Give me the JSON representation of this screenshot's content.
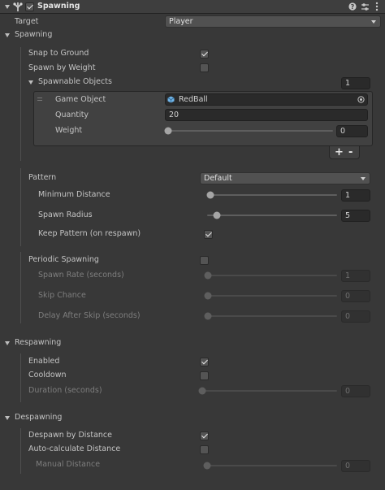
{
  "header": {
    "component_name": "Spawning"
  },
  "target": {
    "label": "Target",
    "value": "Player"
  },
  "spawning": {
    "label": "Spawning",
    "snap_to_ground": {
      "label": "Snap to Ground",
      "checked": true
    },
    "spawn_by_weight": {
      "label": "Spawn by Weight",
      "checked": false
    },
    "spawnable_objects": {
      "label": "Spawnable Objects",
      "count": "1",
      "element": {
        "game_object": {
          "label": "Game Object",
          "value": "RedBall"
        },
        "quantity": {
          "label": "Quantity",
          "value": "20"
        },
        "weight": {
          "label": "Weight",
          "value": "0",
          "slider_fraction": 0.0
        }
      },
      "add_label": "+",
      "remove_label": "-"
    },
    "pattern": {
      "label": "Pattern",
      "value": "Default",
      "minimum_distance": {
        "label": "Minimum Distance",
        "value": "1",
        "slider_fraction": 0.02
      },
      "spawn_radius": {
        "label": "Spawn Radius",
        "value": "5",
        "slider_fraction": 0.07
      },
      "keep_pattern": {
        "label": "Keep Pattern (on respawn)",
        "checked": true
      }
    },
    "periodic": {
      "label": "Periodic Spawning",
      "checked": false,
      "spawn_rate": {
        "label": "Spawn Rate (seconds)",
        "value": "1",
        "slider_fraction": 0.0
      },
      "skip_chance": {
        "label": "Skip Chance",
        "value": "0",
        "slider_fraction": 0.0
      },
      "delay_after_skip": {
        "label": "Delay After Skip (seconds)",
        "value": "0",
        "slider_fraction": 0.0
      }
    }
  },
  "respawning": {
    "label": "Respawning",
    "enabled": {
      "label": "Enabled",
      "checked": true
    },
    "cooldown": {
      "label": "Cooldown",
      "checked": false
    },
    "duration": {
      "label": "Duration (seconds)",
      "value": "0",
      "slider_fraction": 0.0
    }
  },
  "despawning": {
    "label": "Despawning",
    "despawn_by_distance": {
      "label": "Despawn by Distance",
      "checked": true
    },
    "auto_calculate": {
      "label": "Auto-calculate Distance",
      "checked": false
    },
    "manual_distance": {
      "label": "Manual Distance",
      "value": "0",
      "slider_fraction": 0.0
    }
  },
  "colors": {
    "background": "#383838",
    "header": "#3e3e3e",
    "field": "#2a2a2a",
    "object_icon": "#6fb4e8"
  },
  "icons": [
    "collapse-triangle",
    "tree-icon",
    "enable-checkbox",
    "help-icon",
    "presets-icon",
    "more-icon",
    "object-picker-icon",
    "cube-icon"
  ]
}
